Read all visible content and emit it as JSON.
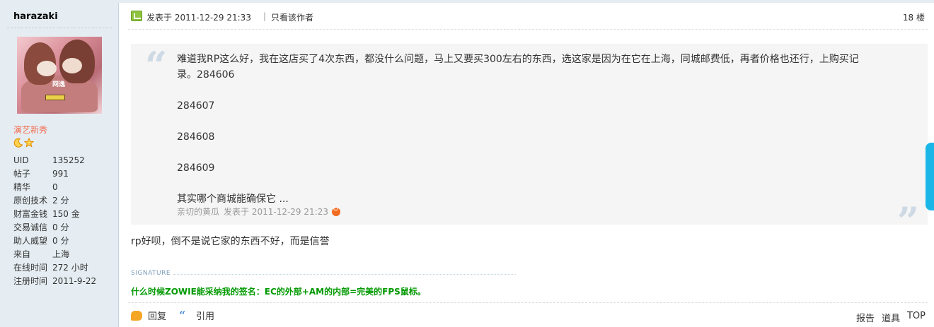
{
  "sidebar": {
    "username": "harazaki",
    "avatar_badge": "网逸",
    "rank": "演艺新秀",
    "stats": [
      {
        "label": "UID",
        "value": "135252"
      },
      {
        "label": "帖子",
        "value": "991"
      },
      {
        "label": "精华",
        "value": "0"
      },
      {
        "label": "原创技术",
        "value": "2 分"
      },
      {
        "label": "财富金钱",
        "value": "150 金"
      },
      {
        "label": "交易诚信",
        "value": "0 分"
      },
      {
        "label": "助人威望",
        "value": "0 分"
      },
      {
        "label": "来自",
        "value": "上海"
      },
      {
        "label": "在线时间",
        "value": "272 小时"
      },
      {
        "label": "注册时间",
        "value": "2011-9-22"
      }
    ]
  },
  "post": {
    "posted_at": "发表于 2011-12-29 21:33",
    "separator": "|",
    "author_only": "只看该作者",
    "floor": "18 楼",
    "quote": {
      "lines": [
        "难道我RP这么好，我在这店买了4次东西，都没什么问题，马上又要买300左右的东西，选这家是因为在它在上海，同城邮费低，再者价格也还行，上购买记",
        "录。284606",
        "284607",
        "284608",
        "284609",
        "其实哪个商城能确保它 ..."
      ],
      "author": "亲切的黄瓜",
      "time": "发表于 2011-12-29 21:23",
      "open_mark": "“",
      "close_mark": "”"
    },
    "reply_text": "rp好呗，倒不是说它家的东西不好，而是信誉",
    "signature_label": "SIGNATURE",
    "signature_text": "什么时候ZOWIE能采纳我的签名：EC的外部+AM的内部=完美的FPS鼠标。",
    "actions": {
      "reply": "回复",
      "quote": "引用",
      "report": "报告",
      "tools": "道具",
      "top": "TOP"
    }
  },
  "icons": {
    "rank_icons": [
      "moon-icon",
      "star-icon"
    ],
    "post_icon": "post-status-icon",
    "jump_icon": "jump-to-post-icon",
    "reply_icon": "reply-icon",
    "quote_icon": "quote-icon"
  },
  "colors": {
    "sidebar_bg": "#e5edf2",
    "rank": "#f26c4f",
    "signature": "#009900",
    "quote_bg": "#f5f5f5"
  }
}
